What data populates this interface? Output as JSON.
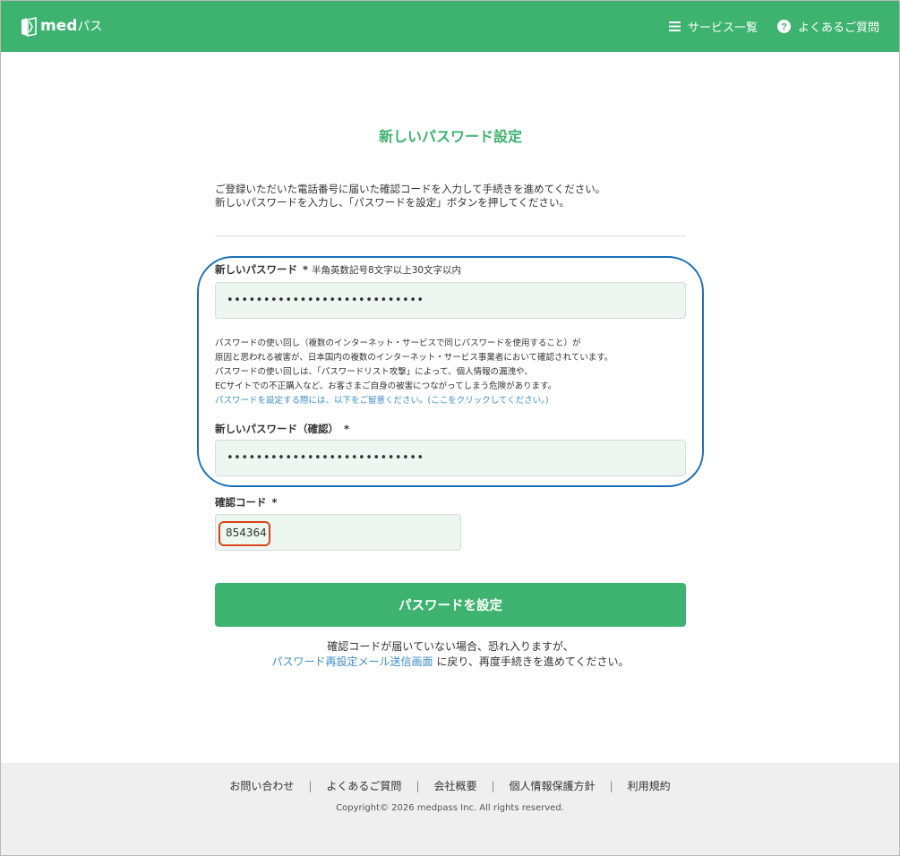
{
  "header": {
    "logo_text": "med",
    "logo_kana": "パス",
    "nav": [
      {
        "label": "サービス一覧",
        "icon": "hamburger-icon"
      },
      {
        "label": "よくあるご質問",
        "icon": "question-circle-icon"
      }
    ]
  },
  "page": {
    "title": "新しいパスワード設定",
    "intro_line1": "ご登録いただいた電話番号に届いた確認コードを入力して手続きを進めてください。",
    "intro_line2": "新しいパスワードを入力し、「パスワードを設定」ボタンを押してください。"
  },
  "form": {
    "password": {
      "label": "新しいパスワード",
      "required": "*",
      "hint": "半角英数記号8文字以上30文字以内",
      "value": "•••••••••••••••••••••••••••"
    },
    "warning": {
      "line1": "パスワードの使い回し（複数のインターネット・サービスで同じパスワードを使用すること）が",
      "line2": "原因と思われる被害が、日本国内の複数のインターネット・サービス事業者において確認されています。",
      "line3": "パスワードの使い回しは、「パスワードリスト攻撃」によって、個人情報の漏洩や、",
      "line4": "ECサイトでの不正購入など、お客さまご自身の被害につながってしまう危険があります。",
      "link": "パスワードを設定する際には、以下をご留意ください。(ここをクリックしてください。)"
    },
    "password_confirm": {
      "label": "新しいパスワード（確認）",
      "required": "*",
      "value": "•••••••••••••••••••••••••••"
    },
    "code": {
      "label": "確認コード",
      "required": "*",
      "value": "854364"
    },
    "submit_label": "パスワードを設定"
  },
  "note": {
    "line1": "確認コードが届いていない場合、恐れ入りますが、",
    "link": "パスワード再設定メール送信画面",
    "line2_rest": " に戻り、再度手続きを進めてください。"
  },
  "footer": {
    "links": [
      "お問い合わせ",
      "よくあるご質問",
      "会社概要",
      "個人情報保護方針",
      "利用規約"
    ],
    "copyright": "Copyright© 2026 medpass Inc. All rights reserved."
  },
  "colors": {
    "brand_green": "#3db36f",
    "link_blue": "#3b8ec9",
    "annotation_blue": "#1c6fb5",
    "annotation_red": "#d9451b"
  }
}
